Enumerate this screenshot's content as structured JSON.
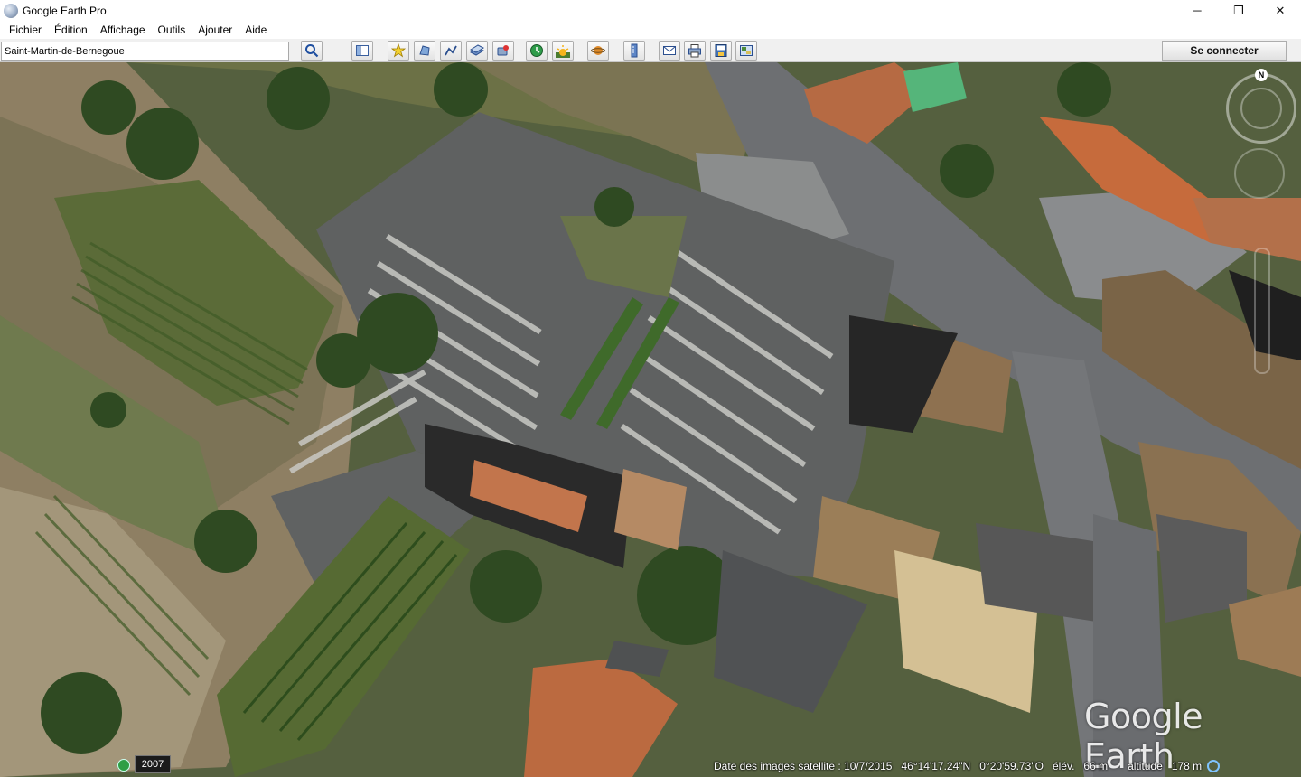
{
  "window": {
    "title": "Google Earth Pro",
    "controls": {
      "minimize": "─",
      "maximize": "❐",
      "close": "✕"
    }
  },
  "menu": [
    {
      "label": "Fichier"
    },
    {
      "label": "Édition"
    },
    {
      "label": "Affichage"
    },
    {
      "label": "Outils"
    },
    {
      "label": "Ajouter"
    },
    {
      "label": "Aide"
    }
  ],
  "toolbar": {
    "search_value": "Saint-Martin-de-Bernegoue",
    "icons": [
      "search-icon",
      "sidebar-icon",
      "placemark-icon",
      "polygon-icon",
      "path-icon",
      "image-overlay-icon",
      "record-tour-icon",
      "historical-imagery-icon",
      "sunlight-icon",
      "planets-icon",
      "ruler-icon",
      "email-icon",
      "print-icon",
      "save-image-icon",
      "maps-view-icon"
    ],
    "connect_label": "Se connecter"
  },
  "map": {
    "compass_north": "N",
    "watermark": "Google Earth",
    "historical_year": "2007",
    "status": {
      "imagery_date": "Date des images satellite : 10/7/2015",
      "latitude": "46°14'17.24\"N",
      "longitude": "0°20'59.73\"O",
      "elevation_label": "élév.",
      "elevation_value": "66 m",
      "altitude_label": "altitude",
      "altitude_value": "178 m"
    }
  }
}
